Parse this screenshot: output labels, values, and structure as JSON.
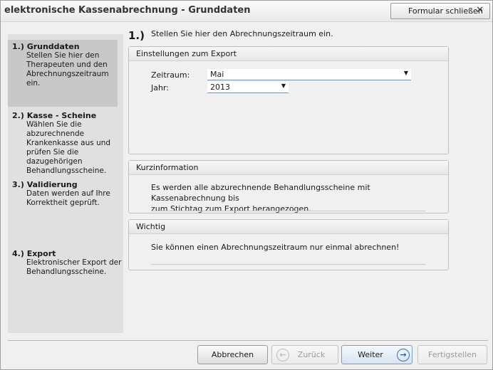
{
  "window": {
    "title": "elektronische Kassenabrechnung - Grunddaten",
    "close_form_label": "Formular schließen",
    "close_form_icon": "close-icon"
  },
  "sidebar": {
    "steps": [
      {
        "title": "1.) Grunddaten",
        "description": [
          "Stellen Sie hier den",
          "Therapeuten und den",
          "Abrechnungszeitraum ein."
        ],
        "active": true
      },
      {
        "title": "2.) Kasse - Scheine",
        "description": [
          "Wählen Sie die",
          "abzurechnende",
          "Krankenkasse aus und",
          "prüfen Sie die",
          "dazugehörigen",
          "Behandlungsscheine."
        ],
        "active": false
      },
      {
        "title": "3.) Validierung",
        "description": [
          "Daten werden auf Ihre",
          "Korrektheit geprüft."
        ],
        "active": false
      },
      {
        "title": "4.) Export",
        "description": [
          "Elektronischer Export der",
          "Behandlungsscheine."
        ],
        "active": false
      }
    ]
  },
  "main": {
    "step_number": "1.)",
    "instruction": "Stellen Sie hier den Abrechnungszeitraum ein.",
    "export_group": {
      "title": "Einstellungen zum Export",
      "period_label": "Zeitraum:",
      "period_value": "Mai",
      "year_label": "Jahr:",
      "year_value": "2013"
    },
    "short_info_group": {
      "title": "Kurzinformation",
      "text_line1": "Es werden alle abzurechnende Behandlungsscheine mit Kassenabrechnung bis",
      "text_line2": "zum Stichtag zum Export herangezogen."
    },
    "important_group": {
      "title": "Wichtig",
      "text": "Sie können einen Abrechnungszeitraum nur einmal abrechnen!"
    }
  },
  "footer": {
    "cancel_label": "Abbrechen",
    "back_label": "Zurück",
    "next_label": "Weiter",
    "finish_label": "Fertigstellen"
  }
}
